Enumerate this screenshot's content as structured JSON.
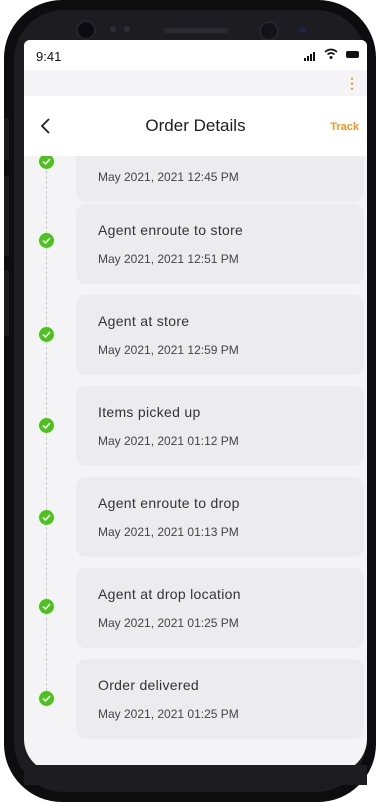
{
  "status_bar": {
    "time": "9:41"
  },
  "header": {
    "title": "Order Details",
    "track_label": "Track"
  },
  "timeline": [
    {
      "label": "",
      "date": "May 2021, 2021 12:45 PM"
    },
    {
      "label": "Agent enroute to store",
      "date": "May 2021, 2021 12:51 PM"
    },
    {
      "label": "Agent at store",
      "date": "May 2021, 2021 12:59 PM"
    },
    {
      "label": "Items picked up",
      "date": "May 2021, 2021 01:12 PM"
    },
    {
      "label": "Agent enroute to drop",
      "date": "May 2021, 2021 01:13 PM"
    },
    {
      "label": "Agent at drop location",
      "date": "May 2021, 2021 01:25 PM"
    },
    {
      "label": "Order delivered",
      "date": "May 2021, 2021 01:25 PM"
    }
  ],
  "colors": {
    "accent": "#f7941d",
    "check": "#4cc31a",
    "card": "#ececef"
  },
  "icons": {
    "back": "chevron-left-icon",
    "menu": "more-vertical-icon",
    "step": "check-circle-icon"
  }
}
